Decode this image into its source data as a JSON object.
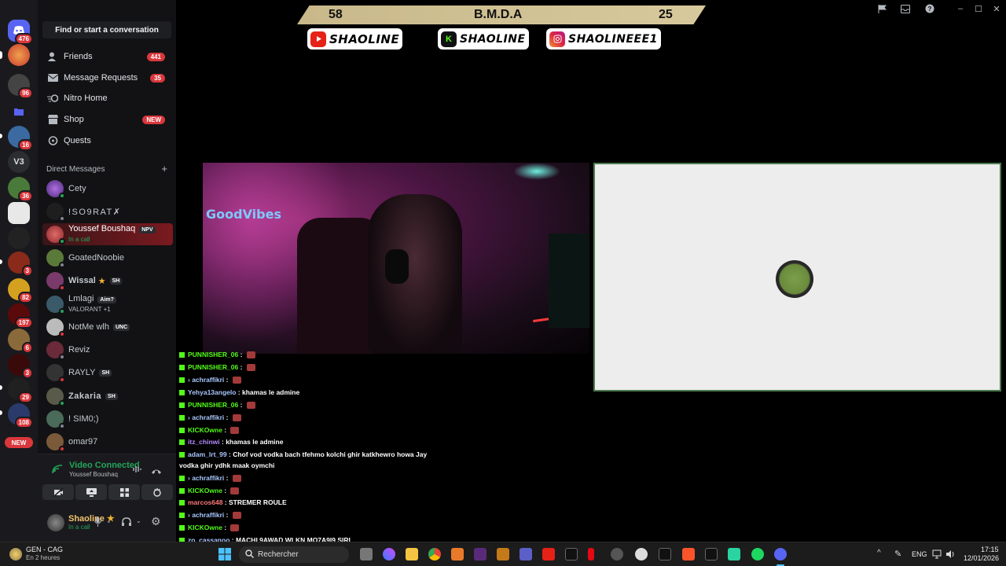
{
  "sidebar": {
    "search_label": "Find or start a conversation",
    "nav": [
      {
        "label": "Friends",
        "count": "441"
      },
      {
        "label": "Message Requests",
        "count": "35"
      },
      {
        "label": "Nitro Home",
        "count": ""
      },
      {
        "label": "Shop",
        "count": "NEW"
      },
      {
        "label": "Quests",
        "count": ""
      }
    ],
    "dm_header": "Direct Messages",
    "dm_add": "+",
    "dms": [
      {
        "name": "Cety",
        "sub": "",
        "tag": ""
      },
      {
        "name": "!SO9RAT✗",
        "sub": "",
        "tag": ""
      },
      {
        "name": "Youssef Boushaq",
        "sub": "In a call",
        "tag": "NPV"
      },
      {
        "name": "GoatedNoobie",
        "sub": "",
        "tag": ""
      },
      {
        "name": "Wissal",
        "sub": "",
        "tag": "SH"
      },
      {
        "name": "Lmlagi",
        "sub": "VALORANT +1",
        "tag": "Aim?"
      },
      {
        "name": "NotMe wlh",
        "sub": "",
        "tag": "UNC"
      },
      {
        "name": "Reviz",
        "sub": "",
        "tag": ""
      },
      {
        "name": "RAYLY",
        "sub": "",
        "tag": "SH"
      },
      {
        "name": "Zakaria",
        "sub": "",
        "tag": "SH"
      },
      {
        "name": "! SIM0;)",
        "sub": "",
        "tag": ""
      },
      {
        "name": "omar97",
        "sub": "",
        "tag": ""
      }
    ]
  },
  "rail": {
    "badges": [
      "476",
      "96",
      "16",
      "36",
      "3",
      "82",
      "197",
      "6",
      "3",
      "29",
      "108"
    ],
    "server_label_v3": "V3",
    "new_label": "NEW"
  },
  "voice": {
    "title": "Video Connected",
    "subtitle": "Youssef Boushaq"
  },
  "user": {
    "name": "Shaoline",
    "status": "In a call"
  },
  "overlay": {
    "score_left": "58",
    "score_title": "B.M.D.A",
    "score_right": "25",
    "handles": [
      "SHAOLINE",
      "SHAOLINE",
      "SHAOLINEEE1"
    ],
    "kick_letter": "K"
  },
  "chat": [
    {
      "user": "PUNNISHER_06",
      "msg": "",
      "emote": true,
      "color": "#53fc18"
    },
    {
      "user": "PUNNISHER_06",
      "msg": "",
      "emote": true,
      "color": "#53fc18"
    },
    {
      "user": "› achraffikri",
      "msg": "",
      "emote": true,
      "color": "#a9c7ff"
    },
    {
      "user": "Yehya13angelo",
      "msg": "khamas le admine",
      "emote": false,
      "color": "#a9c7ff"
    },
    {
      "user": "PUNNISHER_06",
      "msg": "",
      "emote": true,
      "color": "#53fc18"
    },
    {
      "user": "› achraffikri",
      "msg": "",
      "emote": true,
      "color": "#a9c7ff"
    },
    {
      "user": "KICKOwne",
      "msg": "",
      "emote": true,
      "color": "#53fc18"
    },
    {
      "user": "itz_chinwi",
      "msg": "khamas le admine",
      "emote": false,
      "color": "#b58cff"
    },
    {
      "user": "adam_lrt_99",
      "msg": "Chof vod vodka bach tfehmo kolchi ghir katkhewro howa Jay",
      "emote": false,
      "color": "#a9c7ff"
    },
    {
      "user": "",
      "msg": "vodka ghir ydhk maak oymchi",
      "emote": false,
      "color": "#a9c7ff"
    },
    {
      "user": "› achraffikri",
      "msg": "",
      "emote": true,
      "color": "#a9c7ff"
    },
    {
      "user": "KICKOwne",
      "msg": "",
      "emote": true,
      "color": "#53fc18"
    },
    {
      "user": "marcos648",
      "msg": "STREMER ROULE",
      "emote": false,
      "color": "#ff7a7a"
    },
    {
      "user": "› achraffikri",
      "msg": "",
      "emote": true,
      "color": "#a9c7ff"
    },
    {
      "user": "KICKOwne",
      "msg": "",
      "emote": true,
      "color": "#53fc18"
    },
    {
      "user": "zo_cassanoo",
      "msg": "MACHI 9AWAD WLKN MO7A9I9 SIRI",
      "emote": false,
      "color": "#a9c7ff"
    }
  ],
  "taskbar": {
    "weather_title": "GEN - CAG",
    "weather_sub": "En 2 heures",
    "search_label": "Rechercher",
    "lang": "ENG",
    "time": "17:15",
    "date": "12/01/2026"
  }
}
